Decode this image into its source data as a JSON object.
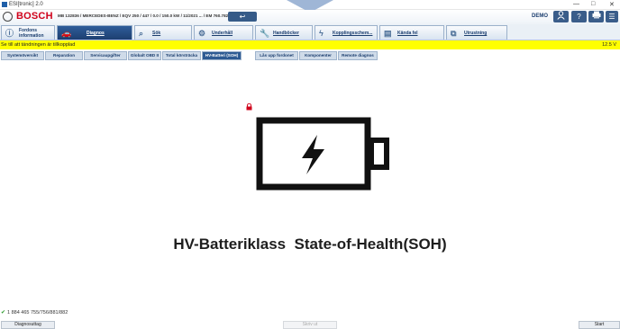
{
  "window": {
    "title": "ESI[tronic] 2.0",
    "minimize": "—",
    "maximize": "□",
    "close": "✕"
  },
  "header": {
    "brand": "BOSCH",
    "vehicle_info": "MB 132836 / MERCEDES-BENZ / EQV 250 / 447 / 0.0 / 150.0 kW / 11/2021 ... / EM 760.782",
    "back_icon": "return-arrow-icon",
    "user_mode": "DEMO",
    "icons": [
      "user-icon",
      "help-icon",
      "printer-icon",
      "menu-icon"
    ]
  },
  "nav": {
    "tabs": [
      {
        "label": "Fordons information",
        "line1": "Fordons",
        "line2": "information",
        "icon": "info-icon"
      },
      {
        "label": "Diagnos",
        "icon": "car-icon",
        "active": true
      },
      {
        "label": "Sök",
        "icon": "search-icon"
      },
      {
        "label": "Underhåll",
        "icon": "gears-icon"
      },
      {
        "label": "Handböcker",
        "icon": "wrench-icon"
      },
      {
        "label": "Kopplingsschem...",
        "icon": "lightning-icon"
      },
      {
        "label": "Kända fel",
        "icon": "book-icon"
      },
      {
        "label": "Utrustning",
        "icon": "external-link-icon"
      }
    ]
  },
  "status": {
    "message": "Se till att tändningen är tillkopplad",
    "voltage": "12.5 V",
    "color": "#ffff00"
  },
  "subtabs": [
    {
      "label": "Systemöversikt"
    },
    {
      "label": "Reparation"
    },
    {
      "label": "Servicaupgifter"
    },
    {
      "label": "Globalt OBD II"
    },
    {
      "label": "Total körsträcka"
    },
    {
      "label": "HV-Batteri (SOH)",
      "active": true
    },
    {
      "label": "Lås upp fordonet"
    },
    {
      "label": "Komponenter"
    },
    {
      "label": "Remote diagnos"
    }
  ],
  "main": {
    "battery_icon": "battery-lightning-icon",
    "title": "HV-Batteriklass  State-of-Health(SOH)"
  },
  "footer": {
    "code": "1 884 465 755/756/881/882",
    "buttons": {
      "left": "Diagnosuttag",
      "middle": "Skriv ut",
      "right": "Start"
    }
  },
  "colors": {
    "accent": "#2d5a93",
    "brand": "#d0021b",
    "status_bar": "#ffff00"
  }
}
